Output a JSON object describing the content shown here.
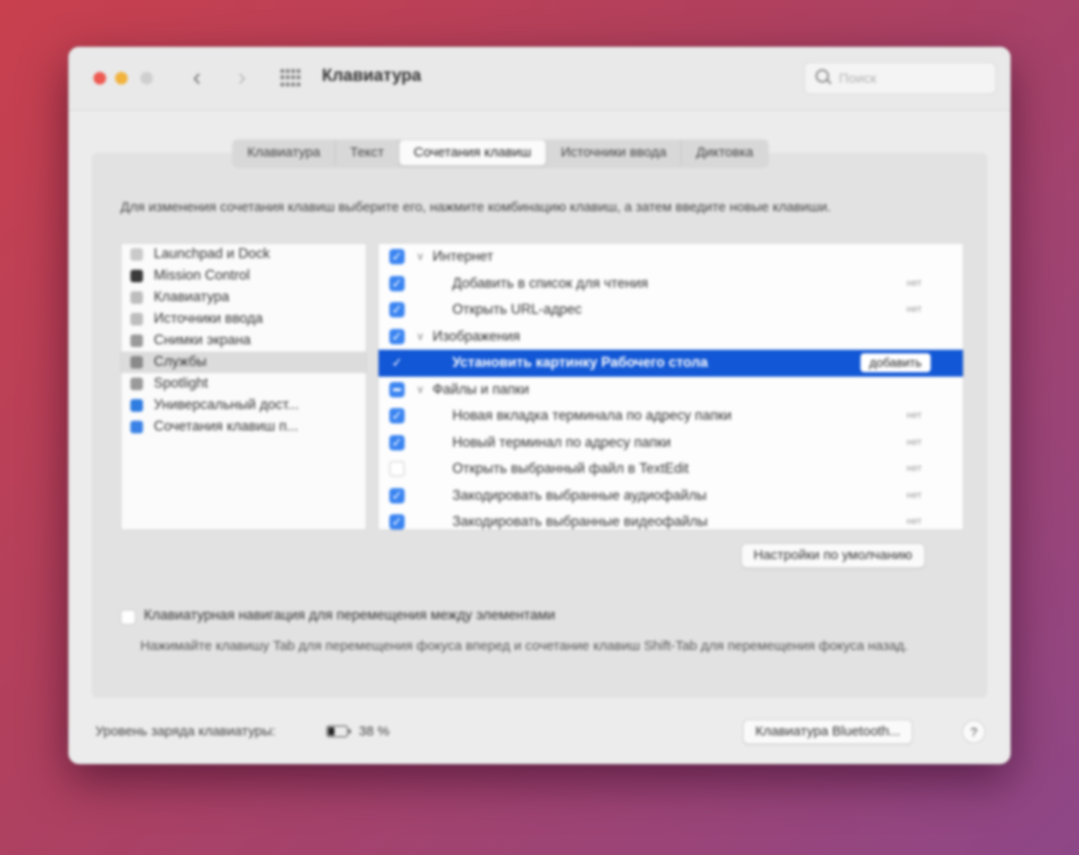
{
  "window": {
    "title": "Клавиатура",
    "search_placeholder": "Поиск"
  },
  "tabs": [
    "Клавиатура",
    "Текст",
    "Сочетания клавиш",
    "Источники ввода",
    "Диктовка"
  ],
  "active_tab": "Сочетания клавиш",
  "description": "Для изменения сочетания клавиш выберите его, нажмите комбинацию клавиш, а затем введите новые клавиши.",
  "categories": [
    {
      "label": "Launchpad и Dock",
      "color": "#c9c9c9"
    },
    {
      "label": "Mission Control",
      "color": "#3a3a3a"
    },
    {
      "label": "Клавиатура",
      "color": "#bdbdbd"
    },
    {
      "label": "Источники ввода",
      "color": "#bdbdbd"
    },
    {
      "label": "Снимки экрана",
      "color": "#9a9a9a"
    },
    {
      "label": "Службы",
      "color": "#8a8a8a"
    },
    {
      "label": "Spotlight",
      "color": "#9a9a9a"
    },
    {
      "label": "Универсальный дост...",
      "color": "#2f7de1"
    },
    {
      "label": "Сочетания клавиш п...",
      "color": "#3b82e6"
    }
  ],
  "selected_category": "Службы",
  "services": [
    {
      "label": "Интернет",
      "group": true,
      "checked": true,
      "shortcut": ""
    },
    {
      "label": "Добавить в список для чтения",
      "group": false,
      "checked": true,
      "shortcut": "нет"
    },
    {
      "label": "Открыть URL-адрес",
      "group": false,
      "checked": true,
      "shortcut": "нет"
    },
    {
      "label": "Изображения",
      "group": true,
      "checked": true,
      "shortcut": ""
    },
    {
      "label": "Установить картинку Рабочего стола",
      "group": false,
      "checked": true,
      "shortcut": "",
      "highlighted": true,
      "button": "добавить"
    },
    {
      "label": "Файлы и папки",
      "group": true,
      "checked": true,
      "mixed": true,
      "shortcut": ""
    },
    {
      "label": "Новая вкладка терминала по адресу папки",
      "group": false,
      "checked": true,
      "shortcut": "нет"
    },
    {
      "label": "Новый терминал по адресу папки",
      "group": false,
      "checked": true,
      "shortcut": "нет"
    },
    {
      "label": "Открыть выбранный файл в TextEdit",
      "group": false,
      "checked": false,
      "shortcut": "нет"
    },
    {
      "label": "Закодировать выбранные аудиофайлы",
      "group": false,
      "checked": true,
      "shortcut": "нет"
    },
    {
      "label": "Закодировать выбранные видеофайлы",
      "group": false,
      "checked": true,
      "shortcut": "нет"
    }
  ],
  "defaults_button": "Настройки по умолчанию",
  "keyboard_navigation": {
    "label": "Клавиатурная навигация для перемещения между элементами",
    "checked": false,
    "description": "Нажимайте клавишу Tab для перемещения фокуса вперед и сочетание клавиш Shift-Tab для перемещения фокуса назад."
  },
  "battery": {
    "label": "Уровень заряда клавиатуры:",
    "percent": 38,
    "value_text": "38 %"
  },
  "bluetooth_button": "Клавиатура Bluetooth...",
  "help_button": "?",
  "colors": {
    "accent": "#3a84f1",
    "highlight": "#1257d6"
  }
}
